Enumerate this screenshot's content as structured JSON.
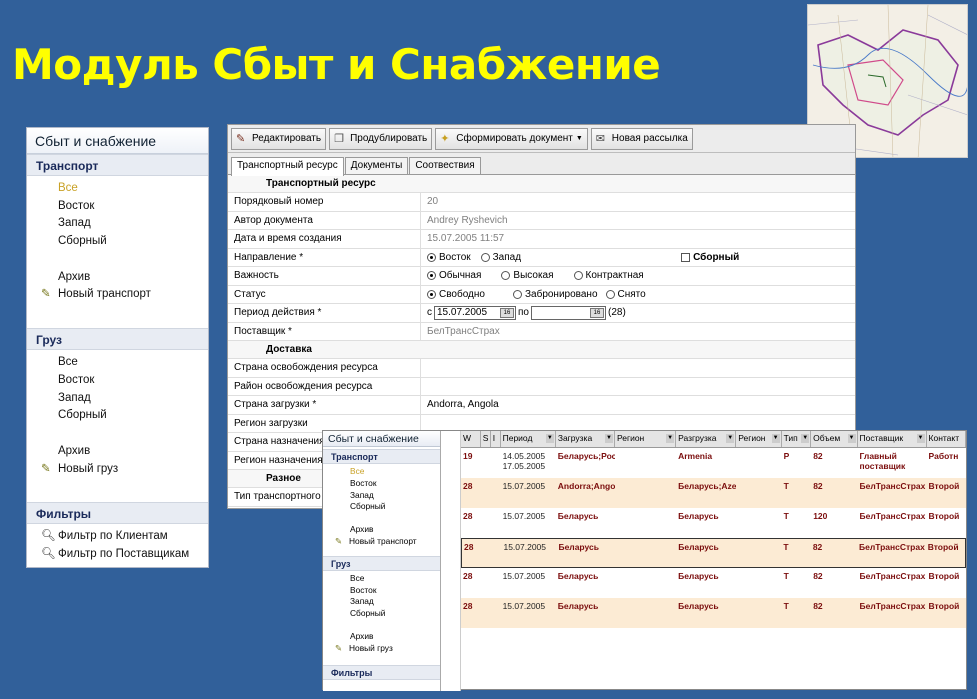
{
  "slide": {
    "title": "Модуль Сбыт и Снабжение"
  },
  "nav": {
    "title": "Сбыт и снабжение",
    "transport": {
      "label": "Транспорт",
      "items": [
        "Все",
        "Восток",
        "Запад",
        "Сборный"
      ],
      "archive": "Архив",
      "new": "Новый транспорт"
    },
    "cargo": {
      "label": "Груз",
      "items": [
        "Все",
        "Восток",
        "Запад",
        "Сборный"
      ],
      "archive": "Архив",
      "new": "Новый груз"
    },
    "filters": {
      "label": "Фильтры",
      "items": [
        "Фильтр по Клиентам",
        "Фильтр по Поставщикам"
      ]
    }
  },
  "toolbar": {
    "edit": "Редактировать",
    "duplicate": "Продублировать",
    "generate": "Сформировать документ",
    "mailing": "Новая рассылка"
  },
  "tabs": [
    "Транспортный ресурс",
    "Документы",
    "Соотвествия"
  ],
  "form": {
    "section1": "Транспортный ресурс",
    "order_label": "Порядковый номер",
    "order_value": "20",
    "author_label": "Автор документа",
    "author_value": "Andrey Ryshevich",
    "created_label": "Дата и время создания",
    "created_value": "15.07.2005 11:57",
    "direction_label": "Направление *",
    "direction_east": "Восток",
    "direction_west": "Запад",
    "direction_combined": "Сборный",
    "priority_label": "Важность",
    "priority_normal": "Обычная",
    "priority_high": "Высокая",
    "priority_contract": "Контрактная",
    "status_label": "Статус",
    "status_free": "Свободно",
    "status_reserved": "Забронировано",
    "status_removed": "Снято",
    "period_label": "Период действия *",
    "period_from_prefix": "с",
    "period_from": "15.07.2005",
    "period_to_prefix": "по",
    "period_days": "(28)",
    "cal_label": "16",
    "supplier_label": "Поставщик *",
    "supplier_value": "БелТрансСтрах",
    "section2": "Доставка",
    "release_country_label": "Страна освобождения ресурса",
    "release_region_label": "Район освобождения ресурса",
    "load_country_label": "Страна загрузки *",
    "load_country_value": "Andorra, Angola",
    "load_region_label": "Регион загрузки",
    "dest_country_label": "Страна назначения *",
    "dest_region_label": "Регион назначения",
    "section3": "Разное",
    "transport_type_label": "Тип транспортного с"
  },
  "overlay": {
    "title": "Сбыт и снабжение",
    "transport": {
      "label": "Транспорт",
      "items": [
        "Все",
        "Восток",
        "Запад",
        "Сборный"
      ],
      "archive": "Архив",
      "new": "Новый транспорт"
    },
    "cargo": {
      "label": "Груз",
      "items": [
        "Все",
        "Восток",
        "Запад",
        "Сборный"
      ],
      "archive": "Архив",
      "new": "Новый груз"
    },
    "filters_label": "Фильтры"
  },
  "grid": {
    "headers": [
      "W",
      "S",
      "I",
      "Период",
      "Загрузка",
      "Регион",
      "Разгрузка",
      "Регион",
      "Тип",
      "Объем",
      "Поставщик",
      "Контакт"
    ],
    "rows": [
      [
        "19",
        "",
        "",
        "14.05.2005\n17.05.2005",
        "Беларусь;Рос",
        "",
        "Armenia",
        "",
        "Р",
        "82",
        "Главный поставщик",
        "Работн"
      ],
      [
        "28",
        "",
        "",
        "15.07.2005",
        "Andorra;Angol",
        "",
        "Беларусь;Aze",
        "",
        "Т",
        "82",
        "БелТрансСтрах",
        "Второй"
      ],
      [
        "28",
        "",
        "",
        "15.07.2005",
        "Беларусь",
        "",
        "Беларусь",
        "",
        "Т",
        "120",
        "БелТрансСтрах",
        "Второй"
      ],
      [
        "28",
        "",
        "",
        "15.07.2005",
        "Беларусь",
        "",
        "Беларусь",
        "",
        "Т",
        "82",
        "БелТрансСтрах",
        "Второй"
      ],
      [
        "28",
        "",
        "",
        "15.07.2005",
        "Беларусь",
        "",
        "Беларусь",
        "",
        "Т",
        "82",
        "БелТрансСтрах",
        "Второй"
      ],
      [
        "28",
        "",
        "",
        "15.07.2005",
        "Беларусь",
        "",
        "Беларусь",
        "",
        "Т",
        "82",
        "БелТрансСтрах",
        "Второй"
      ]
    ]
  },
  "colors": {
    "background": "#31609a",
    "title": "#ffff00",
    "row_text": "#7b0d0d",
    "row_alt": "#fcebd4"
  }
}
